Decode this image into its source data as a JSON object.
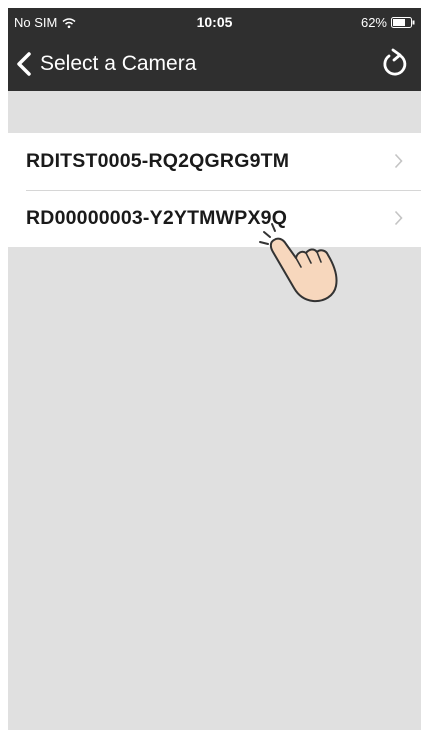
{
  "status_bar": {
    "carrier": "No SIM",
    "time": "10:05",
    "battery": "62%"
  },
  "nav": {
    "title": "Select a Camera",
    "back_icon": "chevron-left-icon",
    "refresh_icon": "refresh-icon"
  },
  "cameras": [
    {
      "name": "RDITST0005-RQ2QGRG9TM"
    },
    {
      "name": "RD00000003-Y2YTMWPX9Q"
    }
  ],
  "colors": {
    "bar_background": "#2f2f2f",
    "page_background": "#e0e0e0",
    "row_background": "#ffffff"
  }
}
